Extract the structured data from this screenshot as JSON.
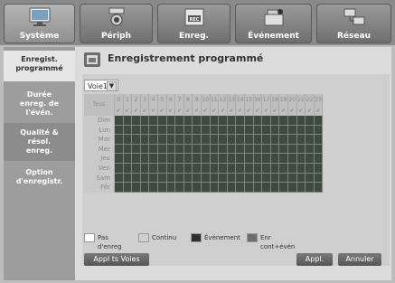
{
  "tabs": [
    {
      "id": "systeme",
      "label": "Système",
      "icon": "monitor-icon",
      "active": true
    },
    {
      "id": "periph",
      "label": "Périph",
      "icon": "camera-icon",
      "active": false
    },
    {
      "id": "enreg",
      "label": "Enreg.",
      "icon": "rec-icon",
      "active": false
    },
    {
      "id": "evenement",
      "label": "Événement",
      "icon": "alarm-icon",
      "active": false
    },
    {
      "id": "reseau",
      "label": "Réseau",
      "icon": "network-icon",
      "active": false
    }
  ],
  "sidebar": [
    {
      "label": "Enregist.\nprogrammé",
      "active": true
    },
    {
      "label": "Durée\nenreg. de\nl'évén.",
      "active": false
    },
    {
      "label": "Qualité &\nrésol.\nenreg.",
      "active": false
    },
    {
      "label": "Option\nd'enregistr.",
      "active": false
    }
  ],
  "page": {
    "title": "Enregistrement programmé",
    "rec_icon": "schedule-icon"
  },
  "channel_select": {
    "value": "Voie1"
  },
  "grid": {
    "all_label": "Tous",
    "hours": [
      "0",
      "1",
      "2",
      "3",
      "4",
      "5",
      "6",
      "7",
      "8",
      "9",
      "10",
      "11",
      "12",
      "13",
      "14",
      "15",
      "16",
      "17",
      "18",
      "19",
      "20",
      "21",
      "22",
      "23"
    ],
    "days": [
      "Dim",
      "Lun",
      "Mar",
      "Mer",
      "Jeu",
      "Ven",
      "Sam",
      "Fér"
    ],
    "cell_color": "#3f4a3f"
  },
  "legend": [
    {
      "label": "Pas d'enreg",
      "color": "#ffffff"
    },
    {
      "label": "Continu",
      "color": "#d0d0d0"
    },
    {
      "label": "Événement",
      "color": "#2e2e2e"
    },
    {
      "label": "Enr cont+évén",
      "color": "#6e6e6e"
    }
  ],
  "buttons": {
    "apply_channels": "Appl ts Voies",
    "apply": "Appl.",
    "cancel": "Annuler"
  }
}
